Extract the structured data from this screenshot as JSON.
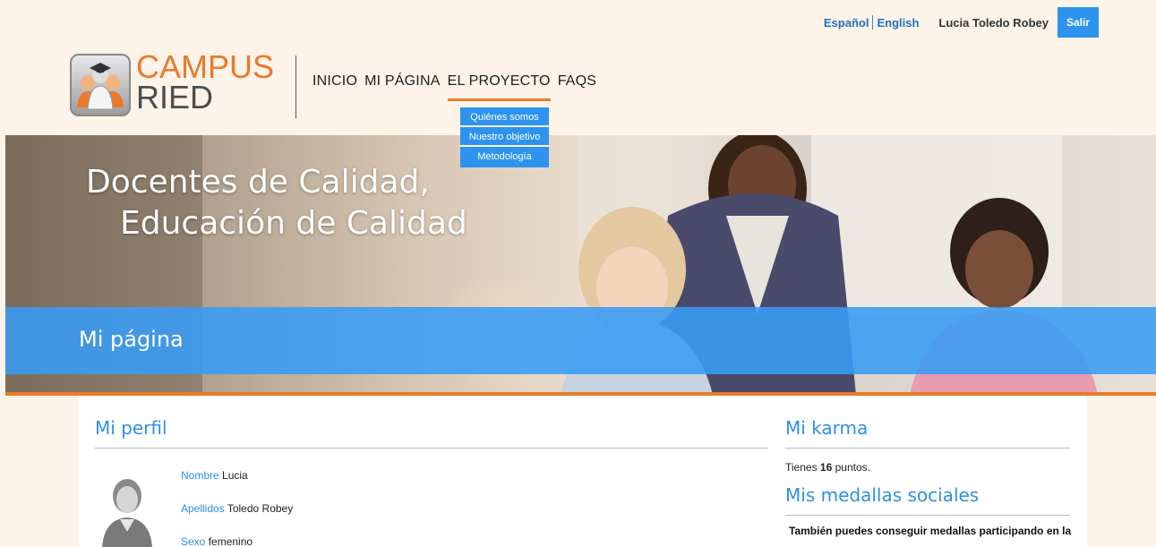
{
  "topbar": {
    "lang_es": "Español",
    "lang_en": "English",
    "user_name": "Lucia Toledo Robey",
    "logout_label": "Salir"
  },
  "logo": {
    "line1": "CAMPUS",
    "line2": "RIED"
  },
  "nav": {
    "items": [
      {
        "label": "INICIO"
      },
      {
        "label": "MI PÁGINA"
      },
      {
        "label": "EL PROYECTO"
      },
      {
        "label": "FAQS"
      }
    ],
    "active_index": 2,
    "dropdown": [
      {
        "label": "Quiénes somos"
      },
      {
        "label": "Nuestro objetivo"
      },
      {
        "label": "Metodología"
      }
    ]
  },
  "banner": {
    "title_line1": "Docentes de Calidad,",
    "title_line2": "Educación de Calidad",
    "page_title": "Mi página"
  },
  "profile": {
    "title": "Mi perfil",
    "fields": [
      {
        "key": "Nombre",
        "value": "Lucia"
      },
      {
        "key": "Apellidos",
        "value": "Toledo Robey"
      },
      {
        "key": "Sexo",
        "value": "femenino"
      }
    ]
  },
  "karma": {
    "title": "Mi karma",
    "text_prefix": "Tienes ",
    "points": "16",
    "text_suffix": " puntos."
  },
  "medals": {
    "title": "Mis medallas sociales",
    "text": "También puedes conseguir medallas participando en la"
  },
  "colors": {
    "accent_blue": "#2d93ef",
    "accent_orange": "#ea7a2a",
    "page_bg": "#fdf3e8"
  },
  "icons": {
    "avatar": "user-silhouette-icon",
    "logo": "campus-ried-logo"
  }
}
